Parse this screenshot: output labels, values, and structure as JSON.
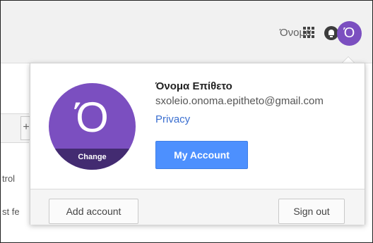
{
  "topbar": {
    "account_name": "Όνομα",
    "avatar_letter": "Ό"
  },
  "background": {
    "plus_label": "+",
    "text1": "trol",
    "text2": "st fe"
  },
  "popup": {
    "user_name": "Όνομα Επίθετο",
    "email": "sxoleio.onoma.epitheto@gmail.com",
    "privacy_label": "Privacy",
    "my_account_label": "My Account",
    "avatar_letter": "Ό",
    "change_label": "Change",
    "add_account_label": "Add account",
    "sign_out_label": "Sign out"
  },
  "colors": {
    "avatar": "#7b4fc0",
    "primary_button": "#4d90fe",
    "link": "#3b6fd0"
  },
  "icons": [
    "apps-grid-icon",
    "notifications-bell-icon"
  ]
}
